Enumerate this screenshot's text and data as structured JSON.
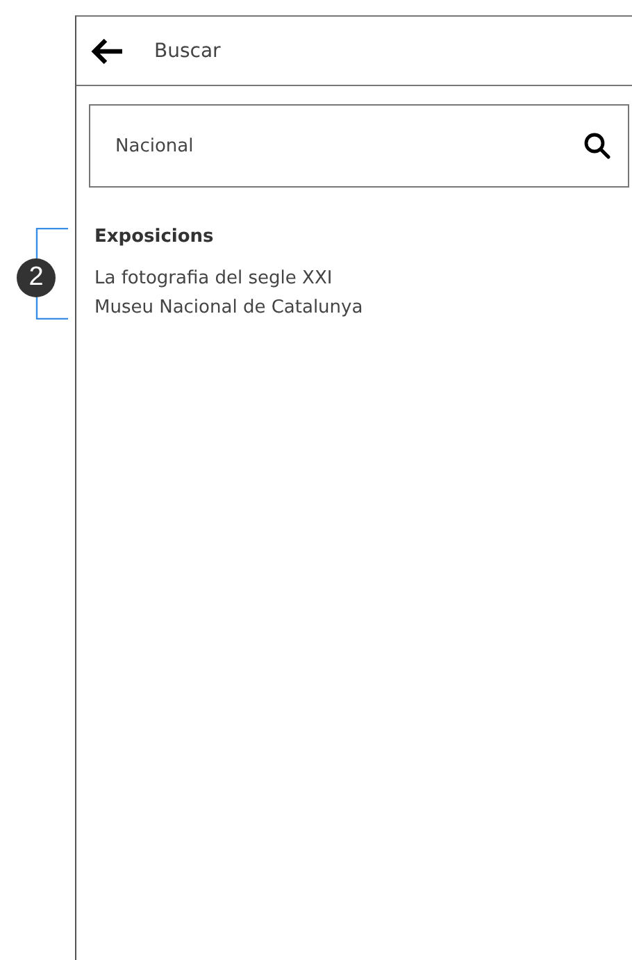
{
  "header": {
    "title": "Buscar"
  },
  "search": {
    "value": "Nacional"
  },
  "sections": [
    {
      "heading": "Exposicions",
      "annotation": "2",
      "results": [
        {
          "title": "La fotografia del segle XXI",
          "venue": "Museu Nacional de Catalunya"
        }
      ]
    }
  ]
}
